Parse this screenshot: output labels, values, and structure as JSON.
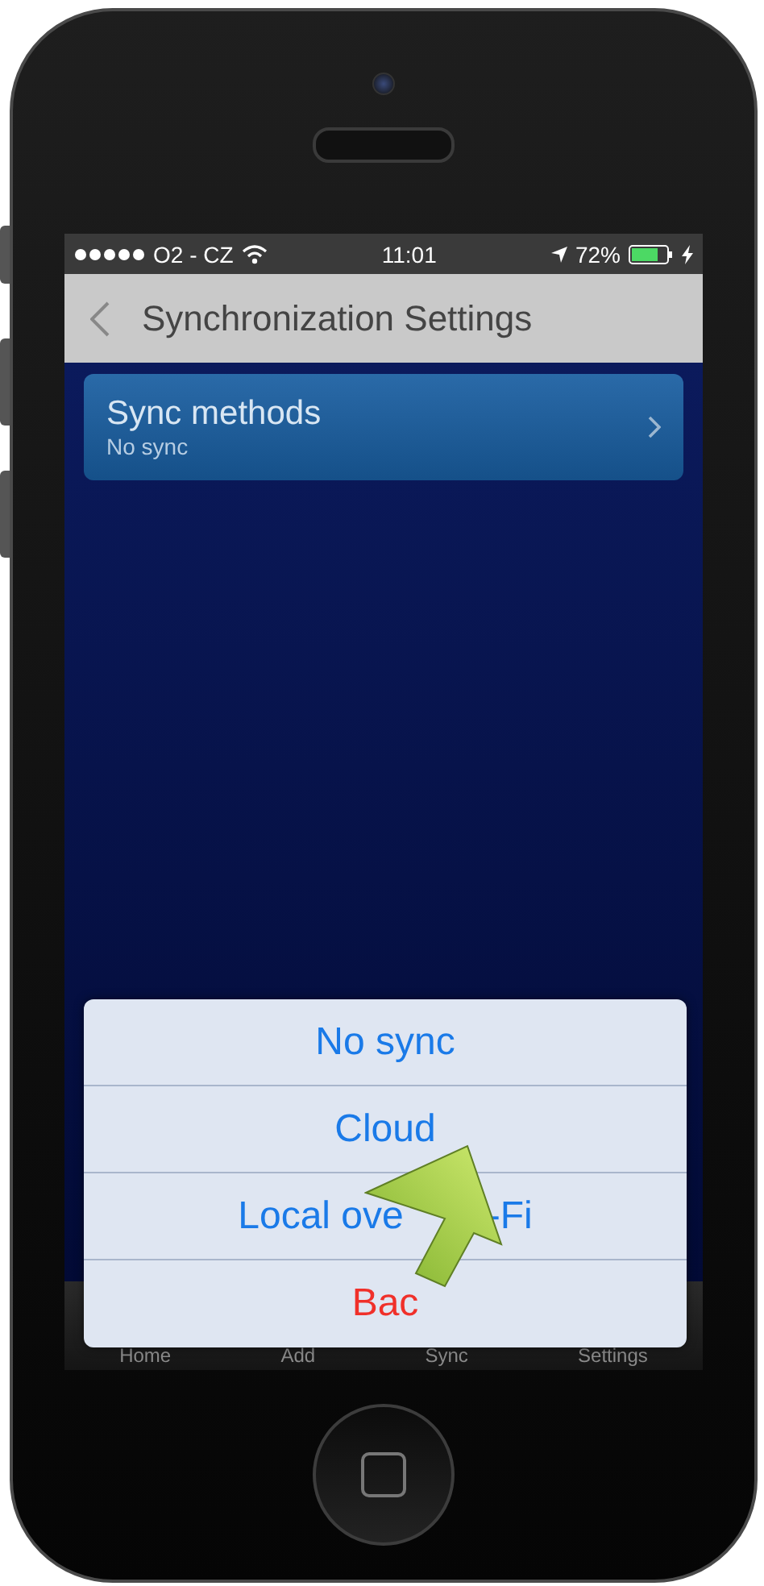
{
  "status_bar": {
    "carrier": "O2 - CZ",
    "time": "11:01",
    "battery": "72%"
  },
  "nav_bar": {
    "title": "Synchronization Settings"
  },
  "settings": [
    {
      "title": "Sync methods",
      "value": "No sync"
    }
  ],
  "tab_bar": [
    "Home",
    "Add",
    "Sync",
    "Settings"
  ],
  "action_sheet": [
    {
      "kind": "option",
      "label": "No sync"
    },
    {
      "kind": "option",
      "label": "Cloud"
    },
    {
      "kind": "option",
      "label": "Local ove",
      "label_end": "-Fi"
    },
    {
      "kind": "cancel",
      "label": "Bac"
    }
  ]
}
